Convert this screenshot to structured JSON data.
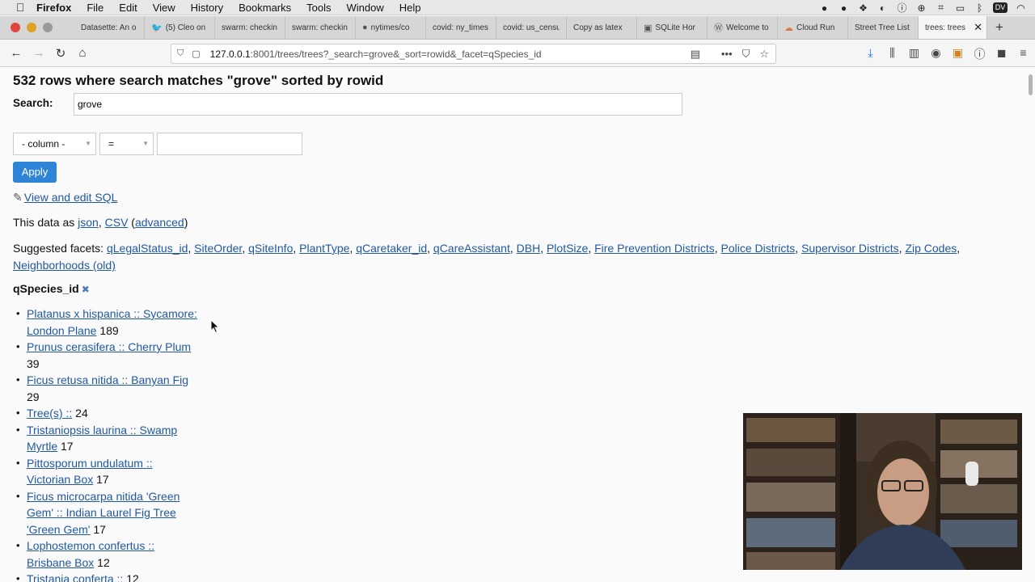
{
  "menubar": {
    "app": "Firefox",
    "items": [
      "File",
      "Edit",
      "View",
      "History",
      "Bookmarks",
      "Tools",
      "Window",
      "Help"
    ],
    "status_icons": [
      "app-icon-1",
      "app-icon-2",
      "dropbox-icon",
      "app-icon-4",
      "info-icon",
      "app-icon-6",
      "app-icon-7",
      "airplay-icon",
      "bluetooth-icon",
      "dv-icon",
      "wifi-icon"
    ],
    "dv_label": "DV"
  },
  "tabs": [
    {
      "label": "Datasette: An o",
      "icon": "generic-favicon"
    },
    {
      "label": "(5) Cleo on",
      "icon": "twitter-favicon"
    },
    {
      "label": "swarm: checkin",
      "icon": "generic-favicon"
    },
    {
      "label": "swarm: checkin",
      "icon": "generic-favicon"
    },
    {
      "label": "nytimes/co",
      "icon": "github-favicon"
    },
    {
      "label": "covid: ny_times",
      "icon": "generic-favicon"
    },
    {
      "label": "covid: us_censu",
      "icon": "generic-favicon"
    },
    {
      "label": "Copy as latex",
      "icon": "generic-favicon"
    },
    {
      "label": "SQLite Hor",
      "icon": "sqlite-favicon"
    },
    {
      "label": "Welcome to",
      "icon": "wp-favicon"
    },
    {
      "label": "Cloud Run",
      "icon": "cloud-favicon"
    },
    {
      "label": "Street Tree List",
      "icon": "generic-favicon"
    },
    {
      "label": "trees: trees",
      "icon": "generic-favicon",
      "active": true
    }
  ],
  "address": {
    "host": "127.0.0.1",
    "rest": ":8001/trees/trees?_search=grove&_sort=rowid&_facet=qSpecies_id"
  },
  "page": {
    "title": "532 rows where search matches \"grove\" sorted by rowid",
    "search_label": "Search:",
    "search_value": "grove",
    "column_select": "- column -",
    "op_select": "=",
    "apply_label": "Apply",
    "edit_sql_icon": "✎",
    "edit_sql_label": "View and edit SQL",
    "data_as_prefix": "This data as ",
    "json_label": "json",
    "sep1": ", ",
    "csv_label": "CSV",
    "paren_open": " (",
    "advanced_label": "advanced",
    "paren_close": ")",
    "suggested_prefix": "Suggested facets: ",
    "suggested_facets": [
      "qLegalStatus_id",
      "SiteOrder",
      "qSiteInfo",
      "PlantType",
      "qCaretaker_id",
      "qCareAssistant",
      "DBH",
      "PlotSize",
      "Fire Prevention Districts",
      "Police Districts",
      "Supervisor Districts",
      "Zip Codes",
      "Neighborhoods (old)"
    ],
    "facet_title": "qSpecies_id",
    "facet_remove": "✖",
    "facet_items": [
      {
        "label": "Platanus x hispanica :: Sycamore: London Plane",
        "count": "189"
      },
      {
        "label": "Prunus cerasifera :: Cherry Plum",
        "count": "39"
      },
      {
        "label": "Ficus retusa nitida :: Banyan Fig",
        "count": "29"
      },
      {
        "label": "Tree(s) ::",
        "count": "24"
      },
      {
        "label": "Tristaniopsis laurina :: Swamp Myrtle",
        "count": "17"
      },
      {
        "label": "Pittosporum undulatum :: Victorian Box",
        "count": "17"
      },
      {
        "label": "Ficus microcarpa nitida 'Green Gem' :: Indian Laurel Fig Tree 'Green Gem'",
        "count": "17"
      },
      {
        "label": "Lophostemon confertus :: Brisbane Box",
        "count": "12"
      },
      {
        "label": "Tristania conferta ::",
        "count": "12"
      }
    ]
  }
}
